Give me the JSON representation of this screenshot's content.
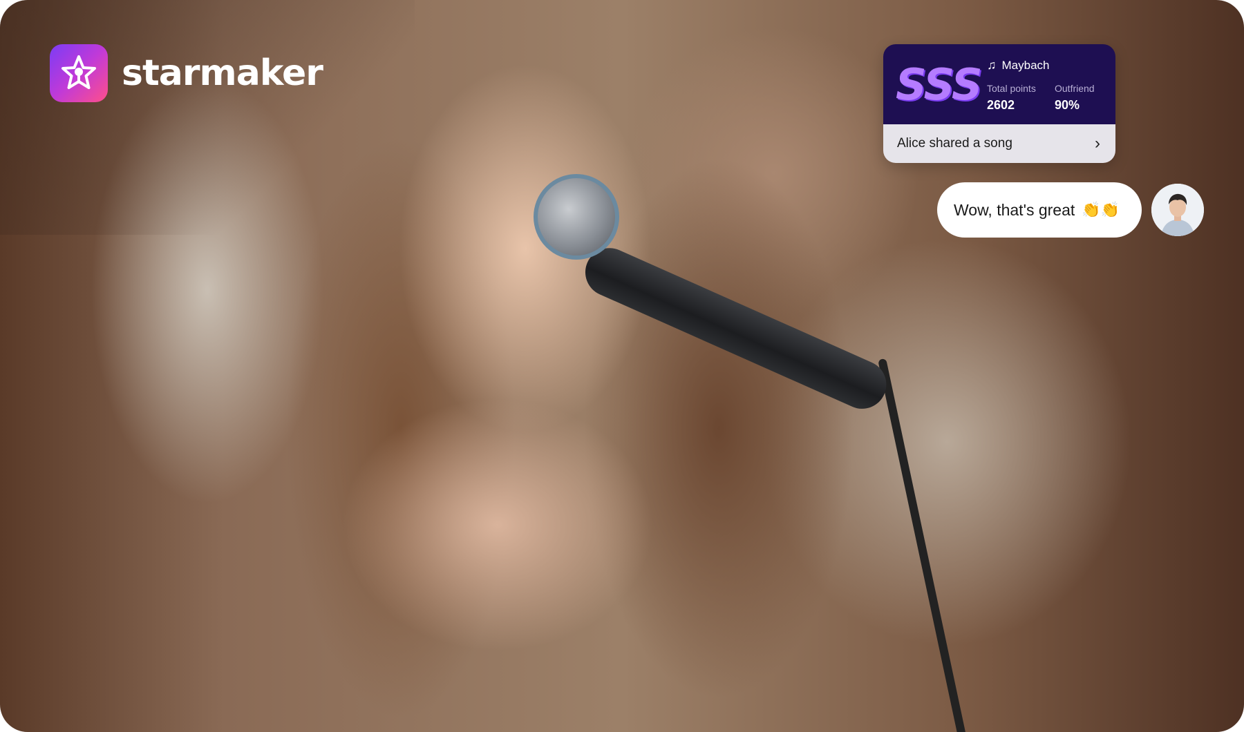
{
  "brand": {
    "name": "starmaker"
  },
  "score_card": {
    "grade": "SSS",
    "song_title": "Maybach",
    "stats": [
      {
        "label": "Total points",
        "value": "2602"
      },
      {
        "label": "Outfriend",
        "value": "90%"
      }
    ],
    "share_text": "Alice shared a song",
    "chevron": "›"
  },
  "comment": {
    "text": "Wow, that's great",
    "emoji": "👏👏"
  },
  "icons": {
    "app_icon": "star-microphone-icon",
    "note": "music-note-icon",
    "chevron": "chevron-right-icon",
    "avatar": "user-avatar"
  },
  "colors": {
    "card_top": "#1e0f52",
    "grade": "#b57cff",
    "card_bottom": "#e6e4ea",
    "icon_gradient_start": "#7b3cf5",
    "icon_gradient_end": "#ff4f8a"
  }
}
